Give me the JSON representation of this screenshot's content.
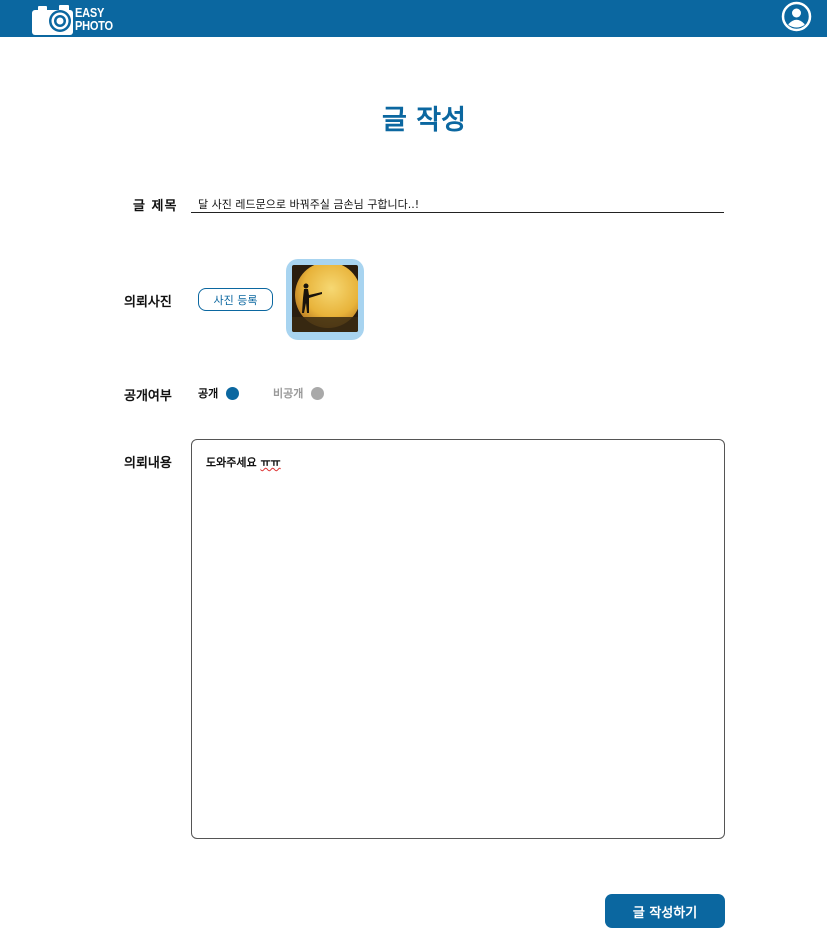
{
  "colors": {
    "brand": "#0b67a0",
    "thumb_frame": "#a8d4f0",
    "radio_on": "#0b67a0",
    "radio_off": "#a9a9a9",
    "text_muted": "#9a9a9a"
  },
  "header": {
    "logo_line1": "EASY",
    "logo_line2": "PHOTO",
    "logo_icon": "camera-icon",
    "profile_icon": "user-circle-icon"
  },
  "page": {
    "title": "글 작성"
  },
  "form": {
    "title_label": "글 제목",
    "title_value": "달 사진 레드문으로 바꿔주실 금손님 구합니다..!",
    "photo_label": "의뢰사진",
    "photo_button": "사진 등록",
    "visibility_label": "공개여부",
    "visibility_options": [
      {
        "label": "공개",
        "selected": true
      },
      {
        "label": "비공개",
        "selected": false
      }
    ],
    "content_label": "의뢰내용",
    "content_text": "도와주세요 ",
    "content_text_marked": "ㅠㅠ",
    "submit_button": "글 작성하기"
  }
}
